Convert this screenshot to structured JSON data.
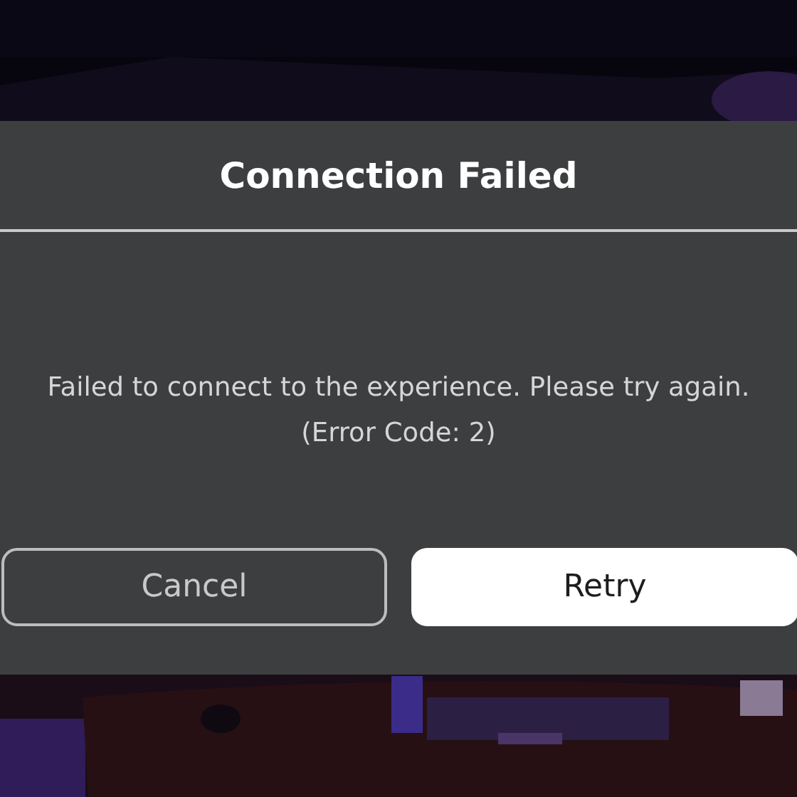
{
  "dialog": {
    "title": "Connection Failed",
    "message": "Failed to connect to the experience. Please try again.",
    "error_code": "(Error Code: 2)",
    "buttons": [
      {
        "label": "Cancel",
        "kind": "secondary"
      },
      {
        "label": "Retry",
        "kind": "primary"
      }
    ]
  }
}
